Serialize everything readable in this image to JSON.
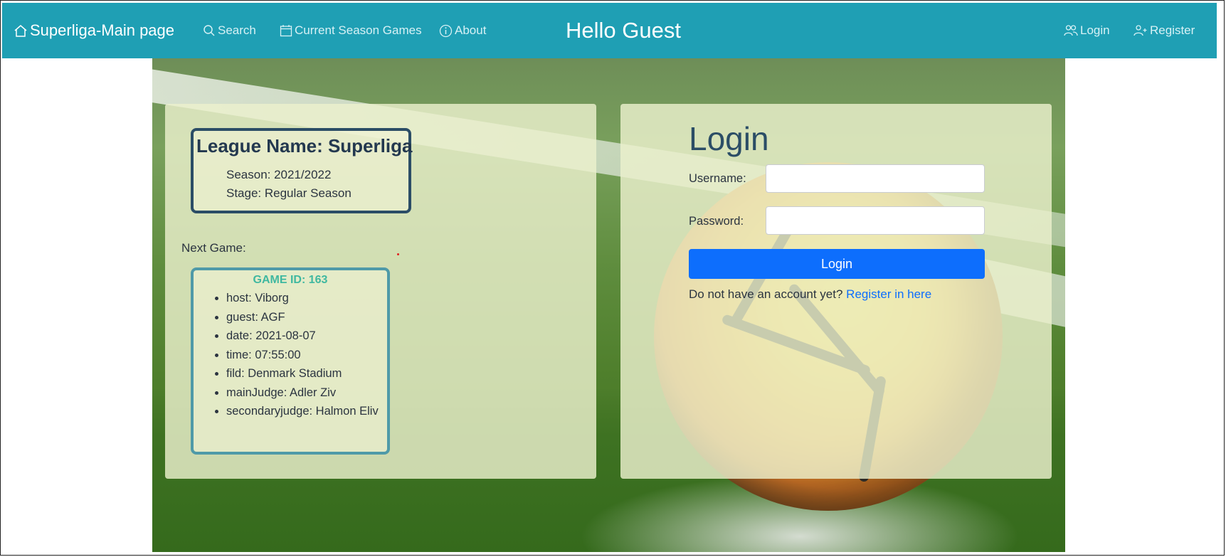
{
  "navbar": {
    "brand": "Superliga-Main page",
    "search": "Search",
    "current_season_games": "Current Season Games",
    "about": "About",
    "greeting": "Hello Guest",
    "login": "Login",
    "register": "Register",
    "background_color": "#1f9fb4",
    "icons": {
      "brand": "home-icon",
      "search": "search-icon",
      "games": "calendar-icon",
      "about": "info-icon",
      "login": "users-icon",
      "register": "user-plus-icon"
    }
  },
  "league": {
    "title": "League Name: Superliga",
    "season": "Season: 2021/2022",
    "stage": "Stage: Regular Season"
  },
  "next_game": {
    "label": "Next Game:",
    "title": "GAME ID: 163",
    "details": [
      "host: Viborg",
      "guest: AGF",
      "date: 2021-08-07",
      "time: 07:55:00",
      "fild: Denmark Stadium",
      "mainJudge: Adler Ziv",
      "secondaryjudge: Halmon Eliv"
    ]
  },
  "login_form": {
    "title": "Login",
    "username_label": "Username:",
    "username_value": "",
    "password_label": "Password:",
    "password_value": "",
    "submit_label": "Login",
    "no_account_text": "Do not have an account yet?",
    "register_link": "Register in here",
    "button_color": "#0d6efd"
  }
}
